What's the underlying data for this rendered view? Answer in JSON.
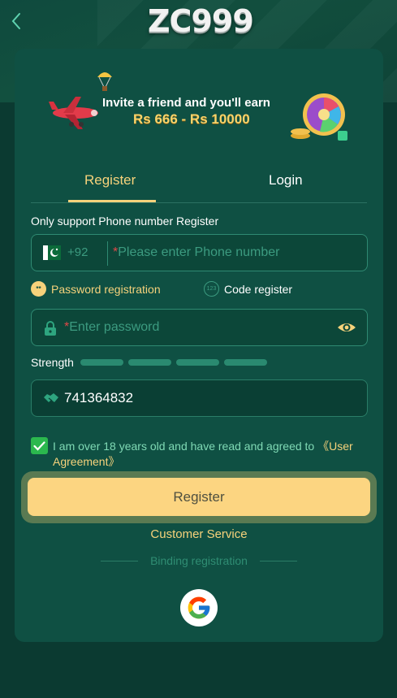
{
  "header": {
    "back_icon": "chevron-left-icon",
    "logo_text": "ZC999"
  },
  "banner": {
    "line1": "Invite a friend and you'll earn",
    "line2": "Rs 666 - Rs 10000"
  },
  "tabs": [
    {
      "label": "Register",
      "active": true
    },
    {
      "label": "Login",
      "active": false
    }
  ],
  "form": {
    "support_note": "Only support Phone number Register",
    "phone": {
      "country_code": "+92",
      "required_mark": "*",
      "placeholder": "Please enter Phone number"
    },
    "modes": {
      "password_label": "Password registration",
      "code_label": "Code register",
      "code_icon_text": "123",
      "password_icon_text": "**"
    },
    "password": {
      "required_mark": "*",
      "placeholder": "Enter password"
    },
    "strength_label": "Strength",
    "invite_code": {
      "value": "741364832"
    },
    "agreement": {
      "text": "I am over 18 years old and have read and agreed to ",
      "link": "《User Agreement》",
      "checked": true
    },
    "submit_label": "Register"
  },
  "footer": {
    "customer_service": "Customer Service",
    "binding_label": "Binding registration",
    "google_icon": "google-icon"
  },
  "colors": {
    "background": "#0b3a31",
    "card": "#0f5043",
    "accent_gold": "#f6d27b",
    "button": "#fcd581",
    "field_border": "#2f8a72",
    "check_green": "#2bb84e"
  }
}
